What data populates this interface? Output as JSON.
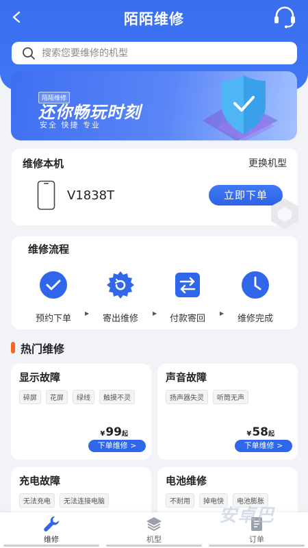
{
  "header": {
    "title": "陌陌维修",
    "back_icon": "chevron-left-icon",
    "support_icon": "headset-icon"
  },
  "search": {
    "placeholder": "搜索您要维修的机型"
  },
  "banner": {
    "tag": "陌陌维修",
    "slogan": "还你畅玩时刻",
    "subtitle": "安全 快捷 专业"
  },
  "device": {
    "title": "维修本机",
    "change_label": "更换机型",
    "model": "V1838T",
    "order_label": "立即下单"
  },
  "flow": {
    "title": "维修流程",
    "steps": [
      {
        "label": "预约下单",
        "icon": "check-circle-icon"
      },
      {
        "label": "寄出维修",
        "icon": "gear-icon"
      },
      {
        "label": "付款寄回",
        "icon": "swap-arrows-icon"
      },
      {
        "label": "维修完成",
        "icon": "clock-icon"
      }
    ]
  },
  "hot": {
    "title": "热门维修",
    "items": [
      {
        "title": "显示故障",
        "tags": [
          "碎屏",
          "花屏",
          "绿线",
          "触摸不灵"
        ],
        "currency": "¥",
        "price": "99",
        "suffix": "起",
        "button": "下单维修 >"
      },
      {
        "title": "声音故障",
        "tags": [
          "扬声器失灵",
          "听筒无声"
        ],
        "currency": "¥",
        "price": "58",
        "suffix": "起",
        "button": "下单维修 >"
      },
      {
        "title": "充电故障",
        "tags": [
          "无法充电",
          "无法连接电脑"
        ]
      },
      {
        "title": "电池维修",
        "tags": [
          "不耐用",
          "掉电快",
          "电池膨胀"
        ]
      }
    ]
  },
  "tabbar": {
    "tabs": [
      {
        "label": "维修"
      },
      {
        "label": "机型"
      },
      {
        "label": "订单"
      }
    ]
  },
  "watermark": "安卓巴",
  "colors": {
    "primary": "#3a6ff0",
    "accent": "#f36a1f"
  }
}
